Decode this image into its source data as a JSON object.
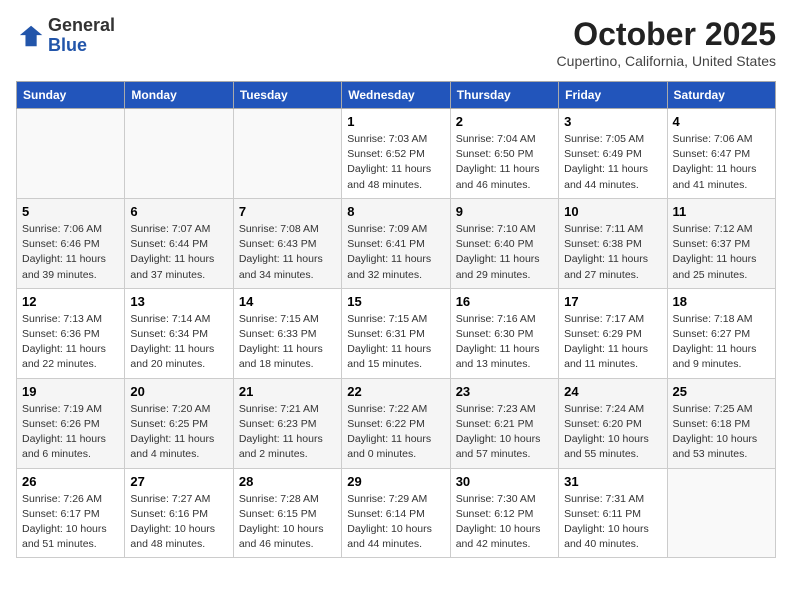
{
  "header": {
    "logo_general": "General",
    "logo_blue": "Blue",
    "month": "October 2025",
    "location": "Cupertino, California, United States"
  },
  "days_of_week": [
    "Sunday",
    "Monday",
    "Tuesday",
    "Wednesday",
    "Thursday",
    "Friday",
    "Saturday"
  ],
  "weeks": [
    [
      {
        "day": "",
        "info": ""
      },
      {
        "day": "",
        "info": ""
      },
      {
        "day": "",
        "info": ""
      },
      {
        "day": "1",
        "info": "Sunrise: 7:03 AM\nSunset: 6:52 PM\nDaylight: 11 hours and 48 minutes."
      },
      {
        "day": "2",
        "info": "Sunrise: 7:04 AM\nSunset: 6:50 PM\nDaylight: 11 hours and 46 minutes."
      },
      {
        "day": "3",
        "info": "Sunrise: 7:05 AM\nSunset: 6:49 PM\nDaylight: 11 hours and 44 minutes."
      },
      {
        "day": "4",
        "info": "Sunrise: 7:06 AM\nSunset: 6:47 PM\nDaylight: 11 hours and 41 minutes."
      }
    ],
    [
      {
        "day": "5",
        "info": "Sunrise: 7:06 AM\nSunset: 6:46 PM\nDaylight: 11 hours and 39 minutes."
      },
      {
        "day": "6",
        "info": "Sunrise: 7:07 AM\nSunset: 6:44 PM\nDaylight: 11 hours and 37 minutes."
      },
      {
        "day": "7",
        "info": "Sunrise: 7:08 AM\nSunset: 6:43 PM\nDaylight: 11 hours and 34 minutes."
      },
      {
        "day": "8",
        "info": "Sunrise: 7:09 AM\nSunset: 6:41 PM\nDaylight: 11 hours and 32 minutes."
      },
      {
        "day": "9",
        "info": "Sunrise: 7:10 AM\nSunset: 6:40 PM\nDaylight: 11 hours and 29 minutes."
      },
      {
        "day": "10",
        "info": "Sunrise: 7:11 AM\nSunset: 6:38 PM\nDaylight: 11 hours and 27 minutes."
      },
      {
        "day": "11",
        "info": "Sunrise: 7:12 AM\nSunset: 6:37 PM\nDaylight: 11 hours and 25 minutes."
      }
    ],
    [
      {
        "day": "12",
        "info": "Sunrise: 7:13 AM\nSunset: 6:36 PM\nDaylight: 11 hours and 22 minutes."
      },
      {
        "day": "13",
        "info": "Sunrise: 7:14 AM\nSunset: 6:34 PM\nDaylight: 11 hours and 20 minutes."
      },
      {
        "day": "14",
        "info": "Sunrise: 7:15 AM\nSunset: 6:33 PM\nDaylight: 11 hours and 18 minutes."
      },
      {
        "day": "15",
        "info": "Sunrise: 7:15 AM\nSunset: 6:31 PM\nDaylight: 11 hours and 15 minutes."
      },
      {
        "day": "16",
        "info": "Sunrise: 7:16 AM\nSunset: 6:30 PM\nDaylight: 11 hours and 13 minutes."
      },
      {
        "day": "17",
        "info": "Sunrise: 7:17 AM\nSunset: 6:29 PM\nDaylight: 11 hours and 11 minutes."
      },
      {
        "day": "18",
        "info": "Sunrise: 7:18 AM\nSunset: 6:27 PM\nDaylight: 11 hours and 9 minutes."
      }
    ],
    [
      {
        "day": "19",
        "info": "Sunrise: 7:19 AM\nSunset: 6:26 PM\nDaylight: 11 hours and 6 minutes."
      },
      {
        "day": "20",
        "info": "Sunrise: 7:20 AM\nSunset: 6:25 PM\nDaylight: 11 hours and 4 minutes."
      },
      {
        "day": "21",
        "info": "Sunrise: 7:21 AM\nSunset: 6:23 PM\nDaylight: 11 hours and 2 minutes."
      },
      {
        "day": "22",
        "info": "Sunrise: 7:22 AM\nSunset: 6:22 PM\nDaylight: 11 hours and 0 minutes."
      },
      {
        "day": "23",
        "info": "Sunrise: 7:23 AM\nSunset: 6:21 PM\nDaylight: 10 hours and 57 minutes."
      },
      {
        "day": "24",
        "info": "Sunrise: 7:24 AM\nSunset: 6:20 PM\nDaylight: 10 hours and 55 minutes."
      },
      {
        "day": "25",
        "info": "Sunrise: 7:25 AM\nSunset: 6:18 PM\nDaylight: 10 hours and 53 minutes."
      }
    ],
    [
      {
        "day": "26",
        "info": "Sunrise: 7:26 AM\nSunset: 6:17 PM\nDaylight: 10 hours and 51 minutes."
      },
      {
        "day": "27",
        "info": "Sunrise: 7:27 AM\nSunset: 6:16 PM\nDaylight: 10 hours and 48 minutes."
      },
      {
        "day": "28",
        "info": "Sunrise: 7:28 AM\nSunset: 6:15 PM\nDaylight: 10 hours and 46 minutes."
      },
      {
        "day": "29",
        "info": "Sunrise: 7:29 AM\nSunset: 6:14 PM\nDaylight: 10 hours and 44 minutes."
      },
      {
        "day": "30",
        "info": "Sunrise: 7:30 AM\nSunset: 6:12 PM\nDaylight: 10 hours and 42 minutes."
      },
      {
        "day": "31",
        "info": "Sunrise: 7:31 AM\nSunset: 6:11 PM\nDaylight: 10 hours and 40 minutes."
      },
      {
        "day": "",
        "info": ""
      }
    ]
  ]
}
